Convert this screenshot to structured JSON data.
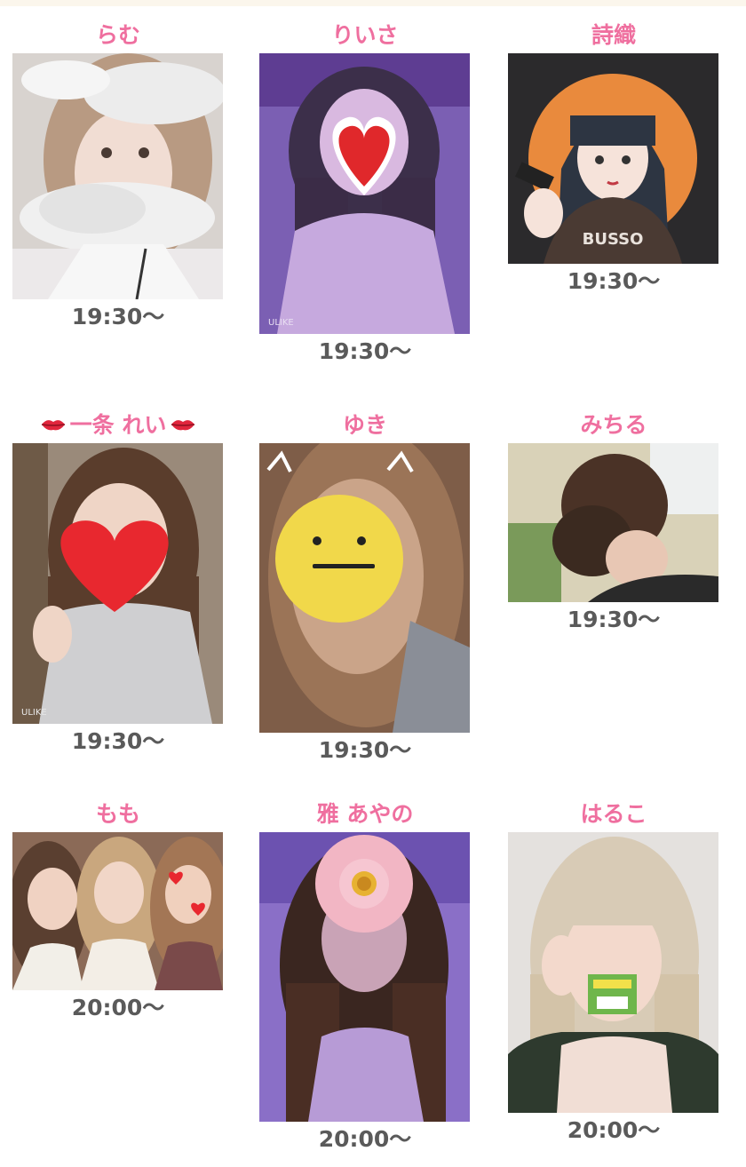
{
  "cast": [
    {
      "name": "らむ",
      "time": "19:30〜",
      "photo": "cloud-mask-photo"
    },
    {
      "name": "りいさ",
      "time": "19:30〜",
      "photo": "heart-sticker-photo"
    },
    {
      "name": "詩織",
      "time": "19:30〜",
      "photo": "illustration-avatar"
    },
    {
      "name": "一条 れい",
      "time": "19:30〜",
      "photo": "heart-face-photo"
    },
    {
      "name": "ゆき",
      "time": "19:30〜",
      "photo": "smiley-face-photo"
    },
    {
      "name": "みちる",
      "time": "19:30〜",
      "photo": "updo-hair-photo"
    },
    {
      "name": "もも",
      "time": "20:00〜",
      "photo": "group-selfie-photo"
    },
    {
      "name": "雅 あやの",
      "time": "20:00〜",
      "photo": "flower-face-photo"
    },
    {
      "name": "はるこ",
      "time": "20:00〜",
      "photo": "mosaic-sticker-photo"
    }
  ],
  "image_texts": {
    "watermark": "ULIKE",
    "shirt_text": "BUSSO"
  },
  "colors": {
    "name": "#ef6f9f",
    "time": "#5a5a5a",
    "topband": "#fbf6ec"
  }
}
